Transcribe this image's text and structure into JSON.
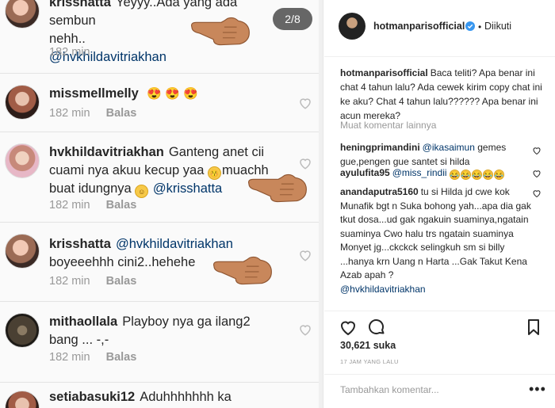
{
  "photo": {
    "counter": "2/8",
    "comments": [
      {
        "user": "krisshatta",
        "text": "Yeyyy..Ada yang ada sembun",
        "line2": "nehh..",
        "mention": "@hvkhildavitriakhan",
        "time": "182 min",
        "reply": ""
      },
      {
        "user": "missmellmelly",
        "emojis": "😍 😍 😍",
        "time": "182 min",
        "reply": "Balas"
      },
      {
        "user": "hvkhildavitriakhan",
        "text": "Ganteng anet cii",
        "line2": "cuami nya akuu kecup yaa",
        "line3a": "muachh",
        "line3b": "buat idungnya",
        "mention": "@krisshatta",
        "time": "182 min",
        "reply": "Balas"
      },
      {
        "user": "krisshatta",
        "mention": "@hvkhildavitriakhan",
        "line2": "boyeeehhh cini2..hehehe",
        "time": "182 min",
        "reply": "Balas"
      },
      {
        "user": "mithaollala",
        "text": "Playboy nya ga ilang2",
        "line2": "bang ... -,-",
        "time": "182 min",
        "reply": "Balas"
      },
      {
        "user": "setiabasuki12",
        "text": "Aduhhhhhhh ka Guanteng"
      }
    ]
  },
  "post": {
    "username": "hotmanparisofficial",
    "follow_dot": "•",
    "follow_label": "Diikuti",
    "caption_user": "hotmanparisofficial",
    "caption_text": "Baca teliti? Apa benar ini chat 4 tahun lalu? Ada cewek kirim copy chat ini ke aku? Chat 4 tahun lalu?????? Apa benar ini acun mereka?",
    "load_more": "Muat komentar lainnya",
    "comments": [
      {
        "user": "heningprimandini",
        "mention": "@ikasaimun",
        "text": "gemes gue,pengen gue santet si hilda"
      },
      {
        "user": "ayulufita95",
        "mention": "@miss_rindii",
        "emoji_count": 5
      },
      {
        "user": "anandaputra5160",
        "text": "tu si Hilda jd cwe kok Munafik bgt n Suka bohong yah...apa dia gak tkut dosa...ud gak ngakuin suaminya,ngatain suaminya Cwo halu trs ngatain suaminya Monyet jg...ckckck selingkuh sm si billy ...hanya krn Uang n Harta ...Gak Takut Kena Azab apah ?",
        "mention_after": "@hvkhildavitriakhan"
      }
    ],
    "likes": "30,621 suka",
    "time": "17 JAM YANG LALU",
    "add_comment_placeholder": "Tambahkan komentar...",
    "more": "•••"
  },
  "icons": {
    "heart": "heart-icon",
    "comment": "comment-icon",
    "bookmark": "bookmark-icon",
    "verified": "verified-badge-icon",
    "pointing_hand": "pointing-hand-icon"
  },
  "colors": {
    "mention": "#003569",
    "muted": "#999999",
    "verified": "#3897f0",
    "hand": "#c8875b"
  }
}
